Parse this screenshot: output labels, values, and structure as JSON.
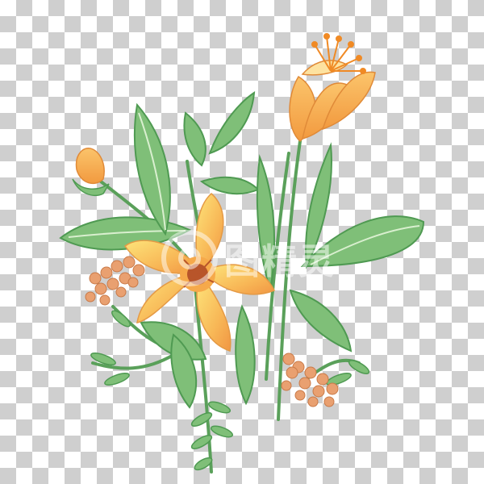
{
  "scene": {
    "description_visible": "",
    "watermark_text": "图精灵",
    "colors": {
      "checker_light": "#ffffff",
      "checker_dark": "#cfcfcf",
      "leaf_fill": "#7fbf78",
      "leaf_dark": "#4f9a52",
      "leaf_vein": "#d9efcf",
      "stem": "#5aa05a",
      "petal_yellow": "#fcd96a",
      "petal_orange": "#f6a94a",
      "petal_deep": "#e07b2a",
      "center": "#b8552a",
      "berry": "#e9a070",
      "berry_highlight": "#f7d3b5"
    }
  }
}
